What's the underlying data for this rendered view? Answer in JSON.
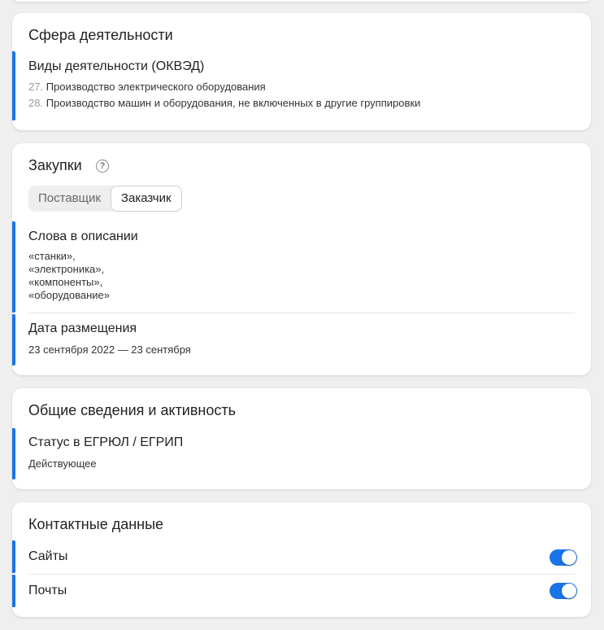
{
  "activity": {
    "title": "Сфера деятельности",
    "okved_label": "Виды деятельности (ОКВЭД)",
    "items": [
      {
        "code": "27.",
        "text": "Производство электрического оборудования"
      },
      {
        "code": "28.",
        "text": "Производство машин и оборудования, не включенных в другие группировки"
      }
    ]
  },
  "purchases": {
    "title": "Закупки",
    "help_icon": "?",
    "tabs": [
      "Поставщик",
      "Заказчик"
    ],
    "active_tab": "Заказчик",
    "keywords_label": "Слова в описании",
    "keywords": [
      "«станки»,",
      "«электроника»,",
      "«компоненты»,",
      "«оборудование»"
    ],
    "date_label": "Дата размещения",
    "date_value": "23 сентября 2022 — 23 сентября"
  },
  "general": {
    "title": "Общие сведения и активность",
    "status_label": "Статус в ЕГРЮЛ / ЕГРИП",
    "status_value": "Действующее"
  },
  "contacts": {
    "title": "Контактные данные",
    "items": [
      {
        "label": "Сайты",
        "enabled": true
      },
      {
        "label": "Почты",
        "enabled": true
      }
    ]
  },
  "colors": {
    "accent": "#1a73e8",
    "background": "#efefef",
    "card": "#ffffff"
  }
}
